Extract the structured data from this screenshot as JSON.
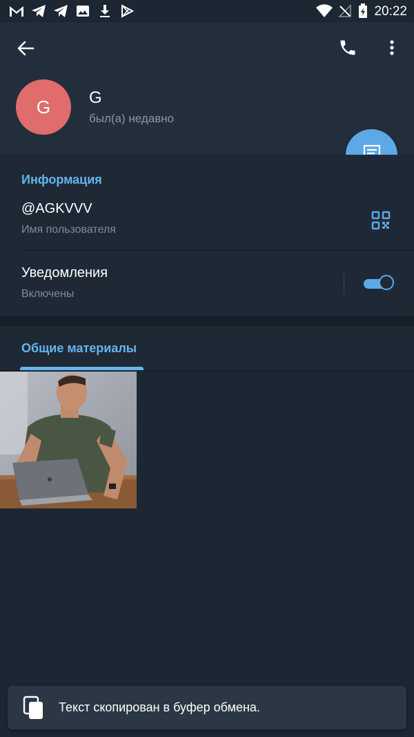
{
  "statusbar": {
    "time": "20:22",
    "left_icons": [
      "gmail-icon",
      "telegram-icon",
      "telegram-icon",
      "image-icon",
      "download-icon",
      "play-store-icon"
    ],
    "right_icons": [
      "wifi-icon",
      "no-signal-icon",
      "battery-charging-icon"
    ]
  },
  "header": {
    "back_icon": "arrow-left-icon",
    "call_icon": "phone-icon",
    "more_icon": "more-vert-icon",
    "avatar_letter": "G",
    "avatar_color": "#e06c6c",
    "name": "G",
    "status": "был(а) недавно",
    "fab_icon": "message-icon"
  },
  "info": {
    "title": "Информация",
    "username": "@AGKVVV",
    "username_label": "Имя пользователя",
    "qr_icon": "qr-code-icon",
    "notifications_label": "Уведомления",
    "notifications_state": "Включены",
    "notifications_enabled": true
  },
  "media": {
    "tab_label": "Общие материалы",
    "items": [
      {
        "type": "photo",
        "icon": "photo-thumbnail"
      }
    ]
  },
  "snackbar": {
    "icon": "copy-icon",
    "text": "Текст скопирован в буфер обмена."
  },
  "colors": {
    "background": "#1d2733",
    "header": "#232e3c",
    "accent": "#64b5ef",
    "fab": "#5ea8e6"
  }
}
